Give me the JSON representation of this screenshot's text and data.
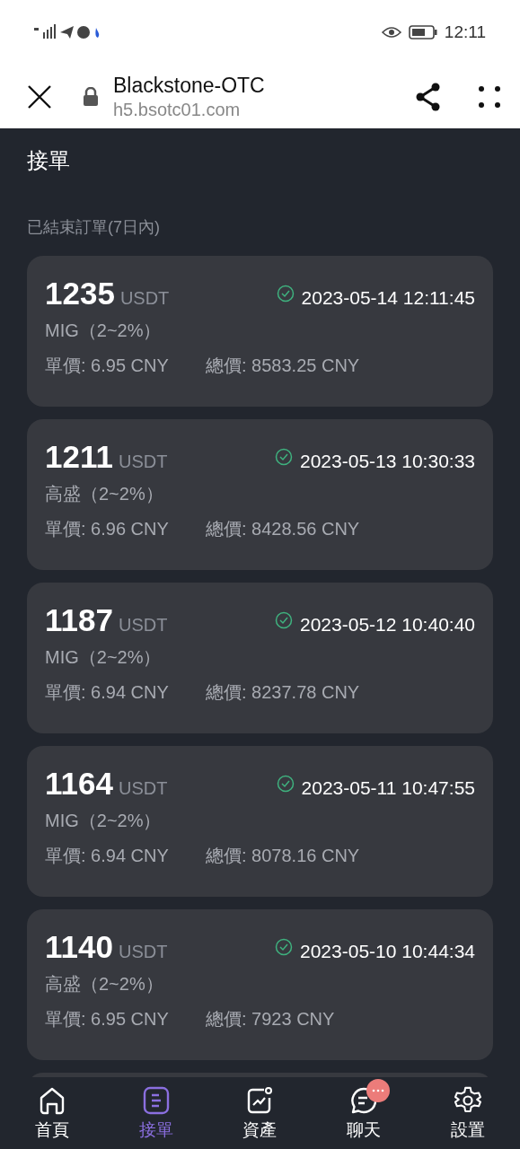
{
  "status_bar": {
    "time": "12:11"
  },
  "browser": {
    "title": "Blackstone-OTC",
    "url": "h5.bsotc01.com"
  },
  "page": {
    "title": "接單",
    "section": "已結束訂單(7日內)"
  },
  "orders": [
    {
      "amount": "1235",
      "unit": "USDT",
      "time": "2023-05-14 12:11:45",
      "merchant": "MIG（2~2%）",
      "price": "單價: 6.95 CNY",
      "total": "總價: 8583.25 CNY"
    },
    {
      "amount": "1211",
      "unit": "USDT",
      "time": "2023-05-13 10:30:33",
      "merchant": "高盛（2~2%）",
      "price": "單價: 6.96 CNY",
      "total": "總價: 8428.56 CNY"
    },
    {
      "amount": "1187",
      "unit": "USDT",
      "time": "2023-05-12 10:40:40",
      "merchant": "MIG（2~2%）",
      "price": "單價: 6.94 CNY",
      "total": "總價: 8237.78 CNY"
    },
    {
      "amount": "1164",
      "unit": "USDT",
      "time": "2023-05-11 10:47:55",
      "merchant": "MIG（2~2%）",
      "price": "單價: 6.94 CNY",
      "total": "總價: 8078.16 CNY"
    },
    {
      "amount": "1140",
      "unit": "USDT",
      "time": "2023-05-10 10:44:34",
      "merchant": "高盛（2~2%）",
      "price": "單價: 6.95 CNY",
      "total": "總價: 7923 CNY"
    }
  ],
  "tabs": [
    {
      "kind": "home",
      "label": "首頁",
      "selected": false,
      "badge": false
    },
    {
      "kind": "orders",
      "label": "接單",
      "selected": true,
      "badge": false
    },
    {
      "kind": "assets",
      "label": "資產",
      "selected": false,
      "badge": false
    },
    {
      "kind": "chat",
      "label": "聊天",
      "selected": false,
      "badge": true
    },
    {
      "kind": "settings",
      "label": "設置",
      "selected": false,
      "badge": false
    }
  ]
}
